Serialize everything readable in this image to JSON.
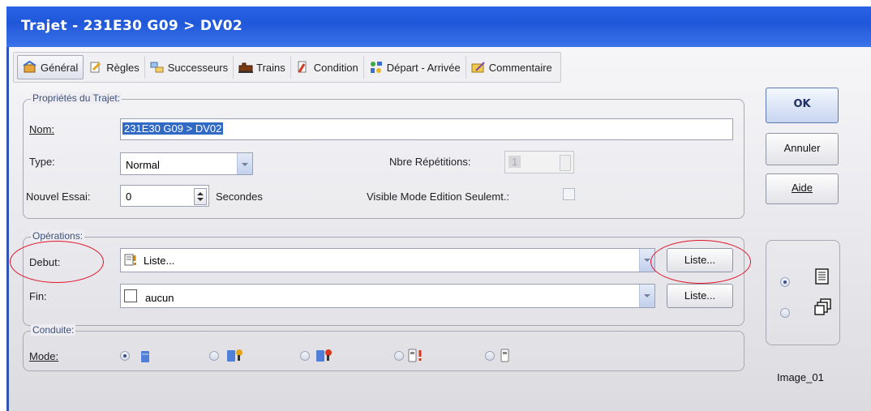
{
  "window": {
    "title": "Trajet - 231E30 G09 > DV02"
  },
  "tabs": [
    {
      "label": "Général",
      "icon": "general-icon"
    },
    {
      "label": "Règles",
      "icon": "rules-icon"
    },
    {
      "label": "Successeurs",
      "icon": "successors-icon"
    },
    {
      "label": "Trains",
      "icon": "trains-icon"
    },
    {
      "label": "Condition",
      "icon": "condition-icon"
    },
    {
      "label": "Départ - Arrivée",
      "icon": "departure-arrival-icon"
    },
    {
      "label": "Commentaire",
      "icon": "comment-icon"
    }
  ],
  "properties": {
    "group_label": "Propriétés du Trajet:",
    "name_label": "Nom:",
    "name_value": "231E30 G09 > DV02",
    "type_label": "Type:",
    "type_value": "Normal",
    "repetitions_label": "Nbre Répétitions:",
    "repetitions_value": "1",
    "retry_label": "Nouvel Essai:",
    "retry_value": "0",
    "retry_unit": "Secondes",
    "visible_label": "Visible Mode Edition Seulemt.:"
  },
  "operations": {
    "group_label": "Opérations:",
    "start_label": "Debut:",
    "start_value": "Liste...",
    "start_button": "Liste...",
    "end_label": "Fin:",
    "end_value": "aucun",
    "end_button": "Liste..."
  },
  "conduct": {
    "group_label": "Conduite:",
    "mode_label": "Mode:"
  },
  "buttons": {
    "ok": "OK",
    "cancel": "Annuler",
    "help": "Aide"
  },
  "image_label": "Image_01",
  "colors": {
    "titlebar": "#1f57d9",
    "highlight": "#316ac5",
    "annotation": "#e0142a"
  }
}
